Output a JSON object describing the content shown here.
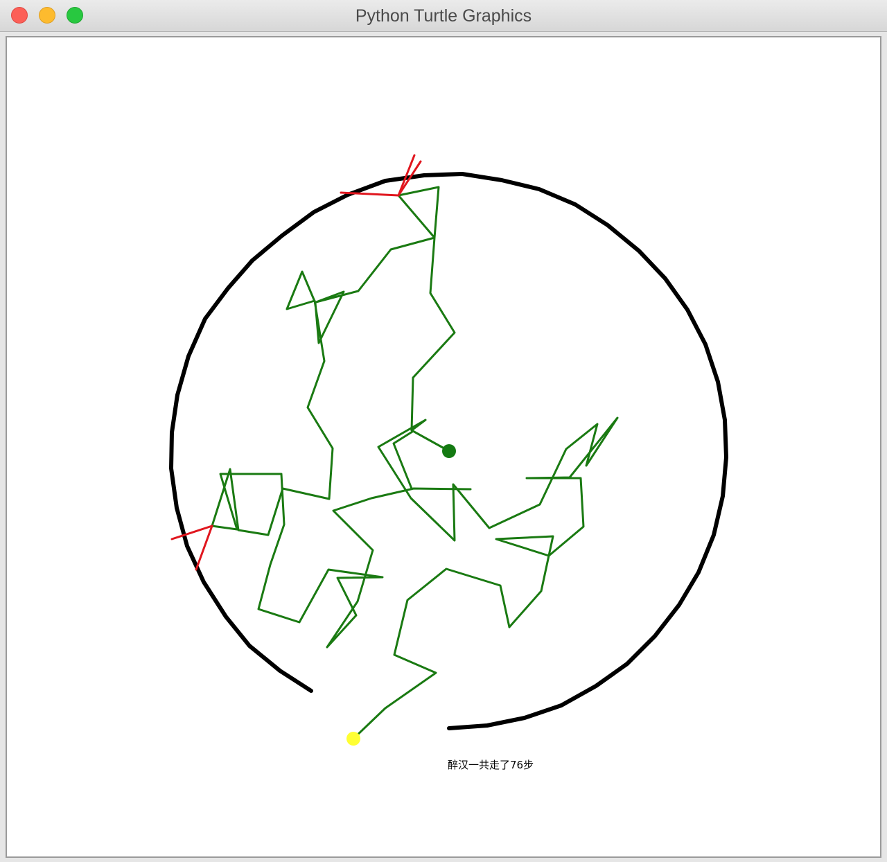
{
  "window": {
    "title": "Python Turtle Graphics",
    "buttons": [
      "close",
      "minimize",
      "zoom"
    ]
  },
  "canvas": {
    "message": "醉汉一共走了76步",
    "colors": {
      "circle": "#000000",
      "path": "#1a7a12",
      "failed_steps": "#e0161e",
      "start_dot": "#147a12",
      "end_dot": "#ffff33"
    }
  }
}
